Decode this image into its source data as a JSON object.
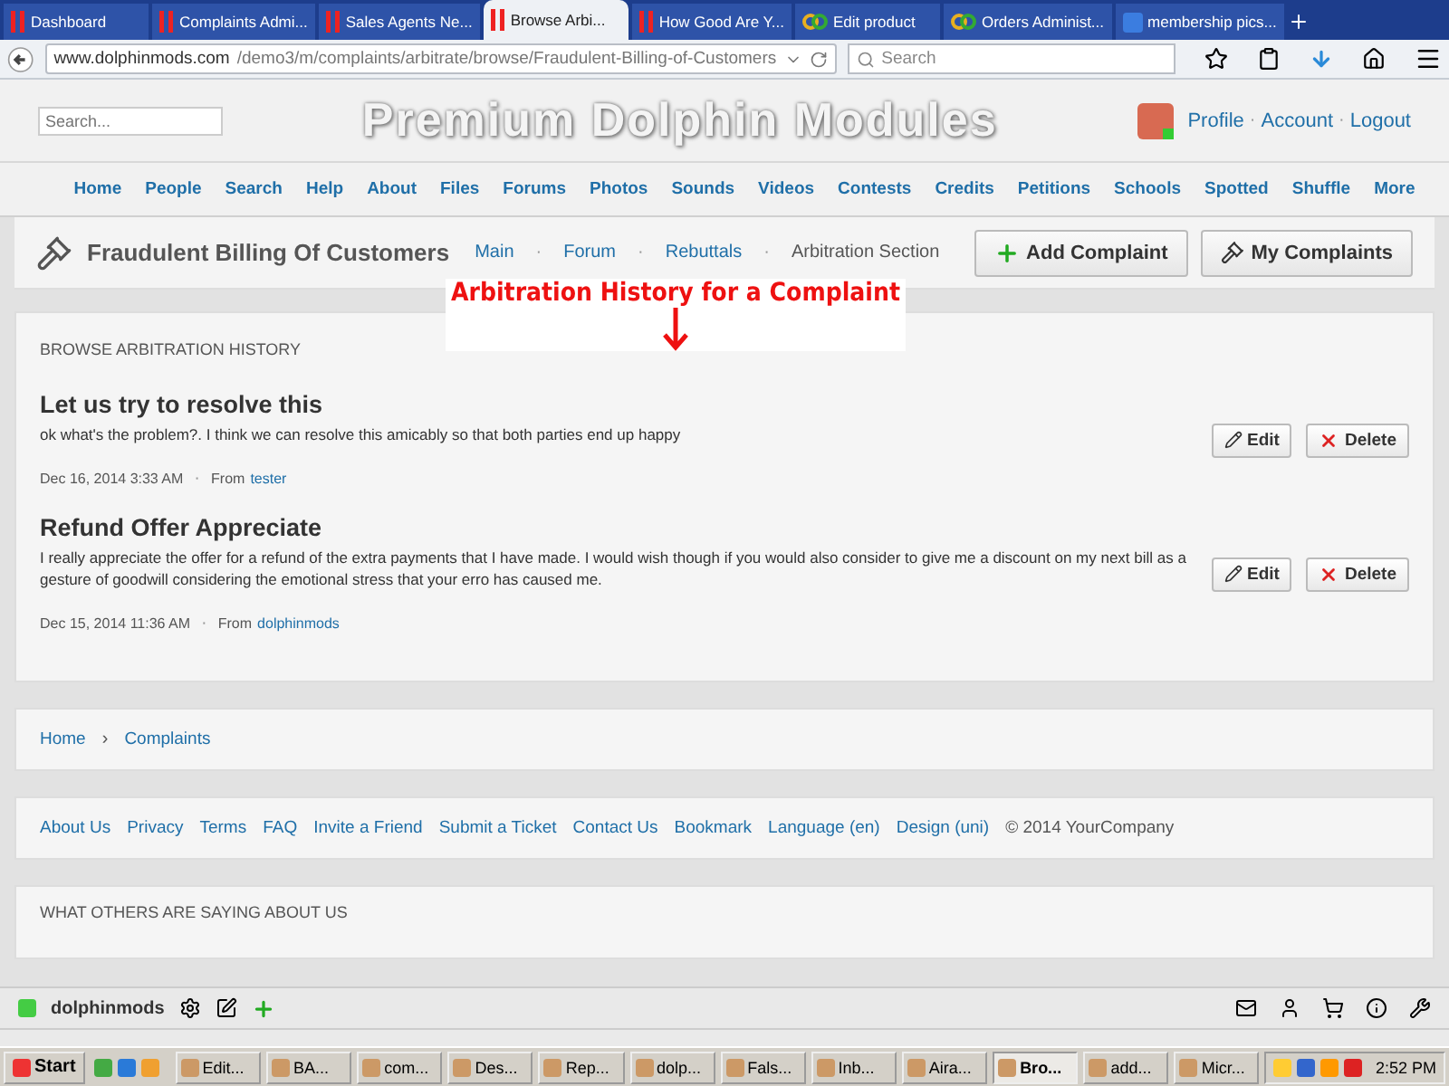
{
  "browser": {
    "tabs": [
      {
        "label": "Dashboard",
        "kind": "dolphin",
        "selected": false
      },
      {
        "label": "Complaints Admi...",
        "kind": "dolphin",
        "selected": false
      },
      {
        "label": "Sales Agents Ne...",
        "kind": "dolphin",
        "selected": false
      },
      {
        "label": "Browse Arbi...",
        "kind": "dolphin",
        "selected": true
      },
      {
        "label": "How Good Are Y...",
        "kind": "dolphin",
        "selected": false
      },
      {
        "label": "Edit product",
        "kind": "rings",
        "selected": false
      },
      {
        "label": "Orders Administ...",
        "kind": "rings",
        "selected": false
      },
      {
        "label": "membership pics...",
        "kind": "g",
        "selected": false
      }
    ],
    "url_host": "www.dolphinmods.com",
    "url_path": "/demo3/m/complaints/arbitrate/browse/Fraudulent-Billing-of-Customers",
    "search_placeholder": "Search"
  },
  "page": {
    "search_placeholder": "Search...",
    "site_title": "Premium Dolphin Modules",
    "separator": "·",
    "user_links": [
      "Profile",
      "Account",
      "Logout"
    ],
    "nav": [
      "Home",
      "People",
      "Search",
      "Help",
      "About",
      "Files",
      "Forums",
      "Photos",
      "Sounds",
      "Videos",
      "Contests",
      "Credits",
      "Petitions",
      "Schools",
      "Spotted",
      "Shuffle",
      "More"
    ],
    "complaint_title": "Fraudulent Billing Of Customers",
    "sub_links": [
      {
        "label": "Main",
        "link": true
      },
      {
        "label": "Forum",
        "link": true
      },
      {
        "label": "Rebuttals",
        "link": true
      },
      {
        "label": "Arbitration Section",
        "link": false
      }
    ],
    "header_buttons": [
      {
        "label": "Add Complaint",
        "kind": "plus"
      },
      {
        "label": "My Complaints",
        "kind": "gavel"
      }
    ],
    "annotation": "Arbitration History for a Complaint",
    "section_title": "BROWSE ARBITRATION HISTORY",
    "entries": [
      {
        "title": "Let us try to resolve this",
        "body": "ok what's the problem?. I think we can resolve this amicably so that both parties end up happy",
        "date": "Dec 16, 2014 3:33 AM",
        "from_label": "From",
        "author": "tester",
        "actions": [
          "Edit",
          "Delete"
        ]
      },
      {
        "title": "Refund Offer Appreciate",
        "body": "I really appreciate the offer for a refund of the extra payments that I have made. I would wish though if you would also consider to give me a discount on my next bill as a gesture of goodwill considering the emotional stress that your erro has caused me.",
        "date": "Dec 15, 2014 11:36 AM",
        "from_label": "From",
        "author": "dolphinmods",
        "actions": [
          "Edit",
          "Delete"
        ]
      }
    ],
    "breadcrumb": [
      "Home",
      "Complaints"
    ],
    "breadcrumb_separator": "›",
    "footer_links": [
      "About Us",
      "Privacy",
      "Terms",
      "FAQ",
      "Invite a Friend",
      "Submit a Ticket",
      "Contact Us",
      "Bookmark",
      "Language (en)",
      "Design (uni)"
    ],
    "copyright": "© 2014 YourCompany",
    "others_title": "WHAT OTHERS ARE SAYING ABOUT US",
    "member_bar": {
      "username": "dolphinmods"
    }
  },
  "taskbar": {
    "start": "Start",
    "items": [
      {
        "label": "Edit...",
        "selected": false
      },
      {
        "label": "BA...",
        "selected": false
      },
      {
        "label": "com...",
        "selected": false
      },
      {
        "label": "Des...",
        "selected": false
      },
      {
        "label": "Rep...",
        "selected": false
      },
      {
        "label": "dolp...",
        "selected": false
      },
      {
        "label": "Fals...",
        "selected": false
      },
      {
        "label": "Inb...",
        "selected": false
      },
      {
        "label": "Aira...",
        "selected": false
      },
      {
        "label": "Bro...",
        "selected": true
      },
      {
        "label": "add...",
        "selected": false
      },
      {
        "label": "Micr...",
        "selected": false
      }
    ],
    "clock": "2:52 PM"
  }
}
